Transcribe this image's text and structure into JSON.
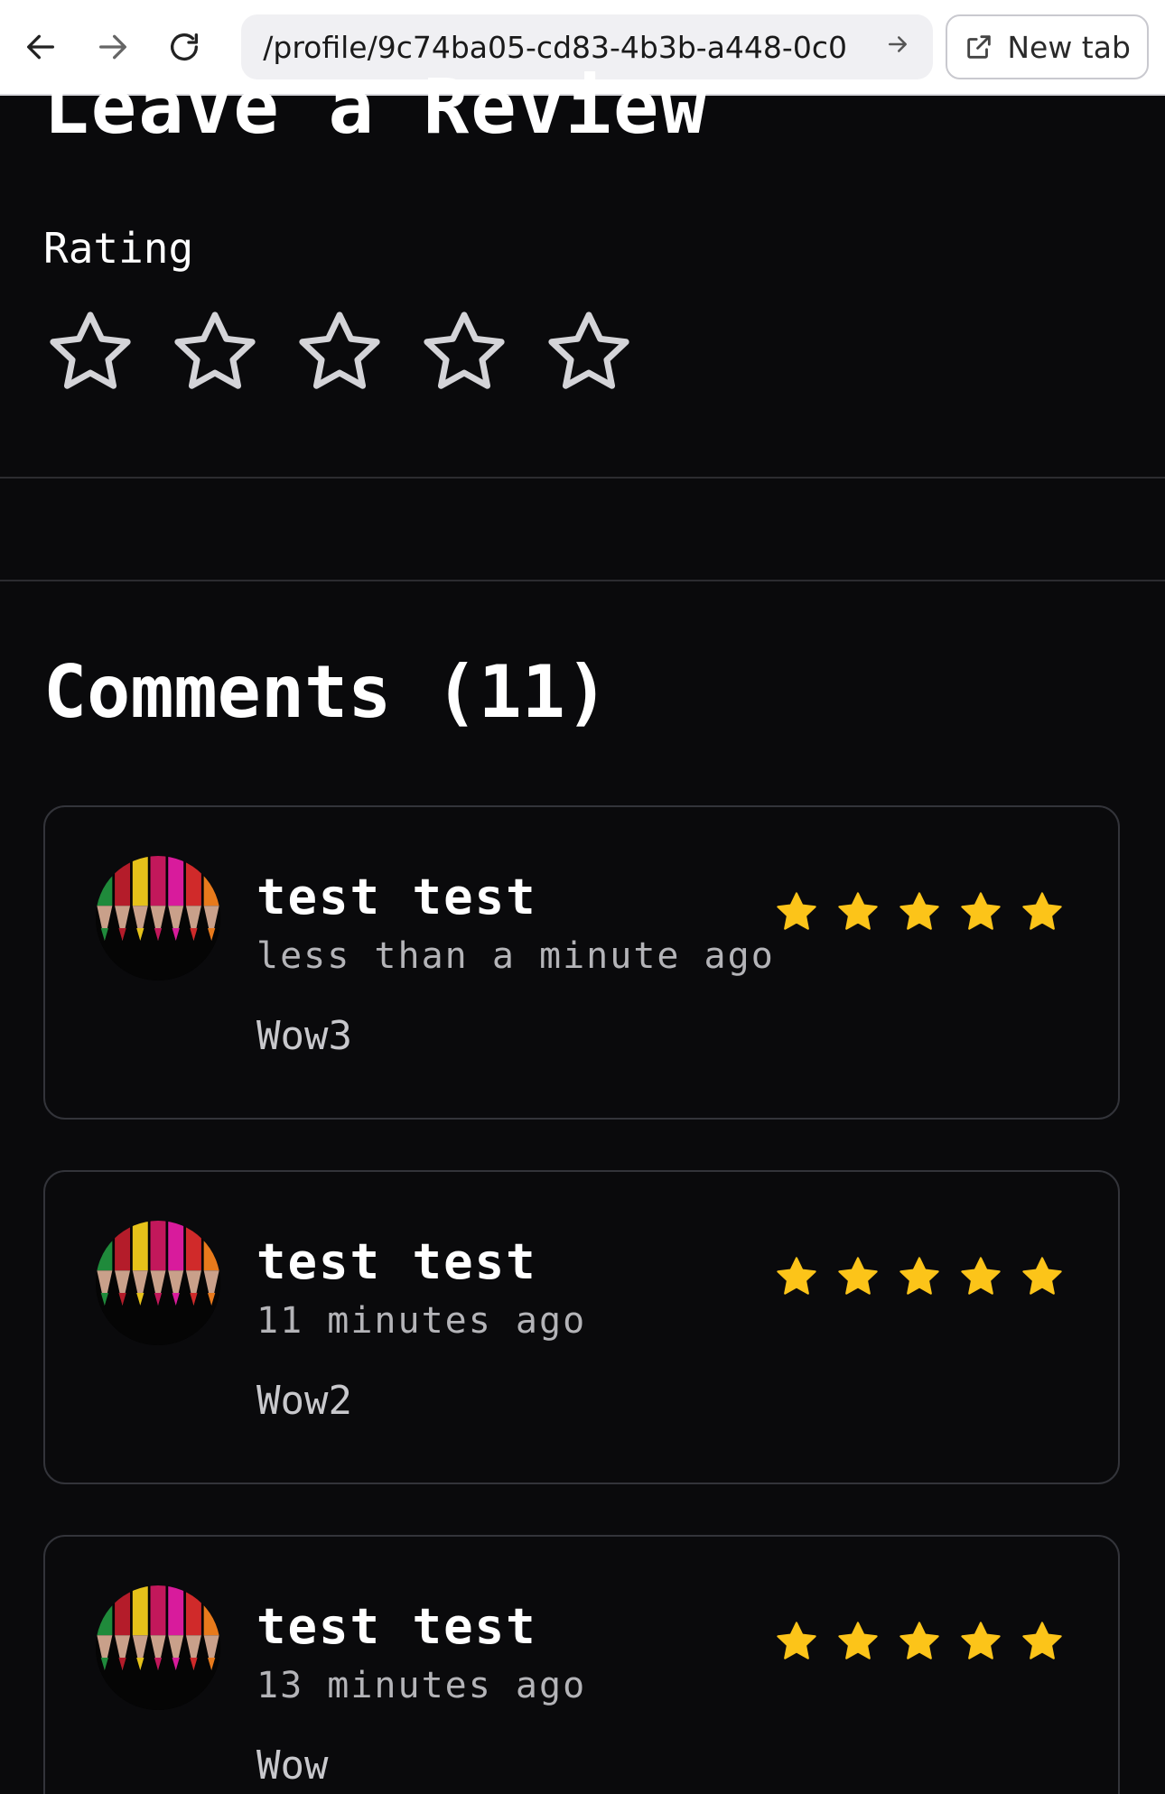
{
  "browser": {
    "url": "/profile/9c74ba05-cd83-4b3b-a448-0c0",
    "new_tab_label": "New tab"
  },
  "review_form": {
    "title": "Leave a Review",
    "rating_label": "Rating",
    "rating_value": 0,
    "rating_max": 5
  },
  "comments": {
    "title": "Comments (11)",
    "items": [
      {
        "name": "test test",
        "time": "less than a minute ago",
        "text": "Wow3",
        "rating": 5
      },
      {
        "name": "test test",
        "time": "11 minutes ago",
        "text": "Wow2",
        "rating": 5
      },
      {
        "name": "test test",
        "time": "13 minutes ago",
        "text": "Wow",
        "rating": 5
      }
    ]
  },
  "colors": {
    "background": "#0a0a0c",
    "star_filled": "#fcc419",
    "star_outline": "#d4d4d8"
  }
}
